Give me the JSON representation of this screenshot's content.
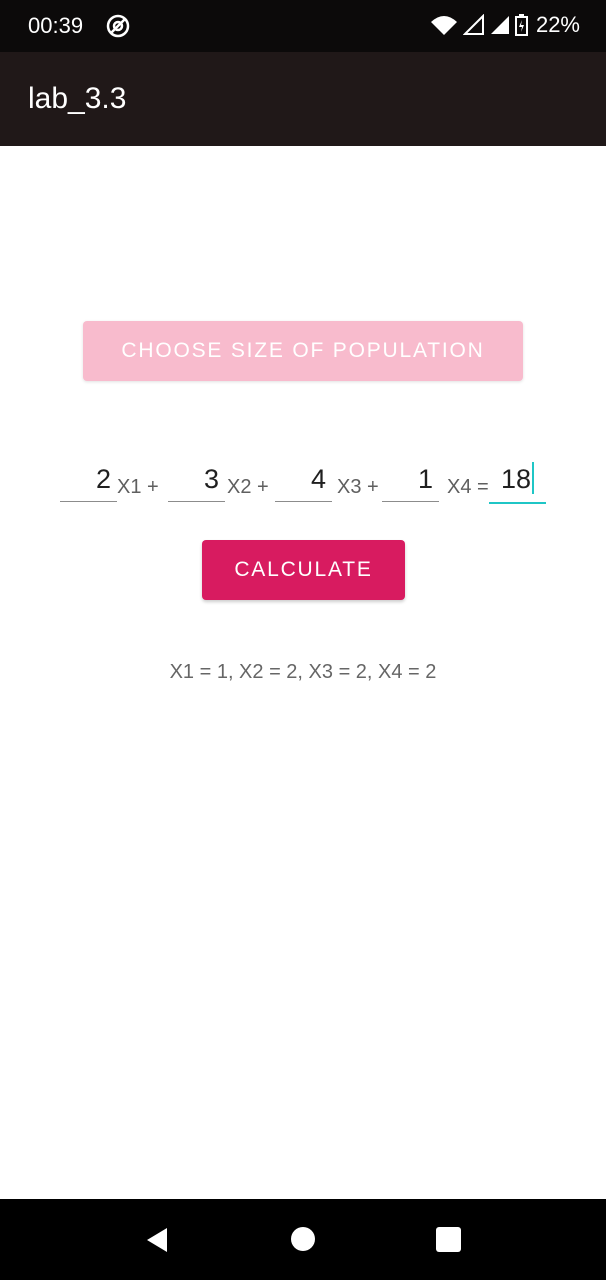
{
  "status_bar": {
    "time": "00:39",
    "battery": "22%",
    "sync_icon": "sync-icon",
    "wifi_icon": "wifi-icon",
    "signal_icon": "signal-icon",
    "battery_icon": "battery-charging-icon"
  },
  "app_bar": {
    "title": "lab_3.3"
  },
  "buttons": {
    "choose_size": "CHOOSE SIZE OF POPULATION",
    "calculate": "CALCULATE"
  },
  "equation": {
    "coefficients": [
      "2",
      "3",
      "4",
      "1"
    ],
    "variable_labels": [
      "X1 +",
      "X2 +",
      "X3 +",
      "X4 ="
    ],
    "result_value": "18"
  },
  "result_text": "X1 = 1, X2 = 2, X3 = 2, X4 = 2",
  "nav_bar": {
    "back_icon": "back-icon",
    "home_icon": "home-icon",
    "recent_icon": "recent-apps-icon"
  },
  "colors": {
    "accent": "#d81b60",
    "disabled_button": "#f8bbcd",
    "focus_underline": "#1fc6c6",
    "app_bar": "#201818",
    "status_bar": "#0c0a0a"
  }
}
